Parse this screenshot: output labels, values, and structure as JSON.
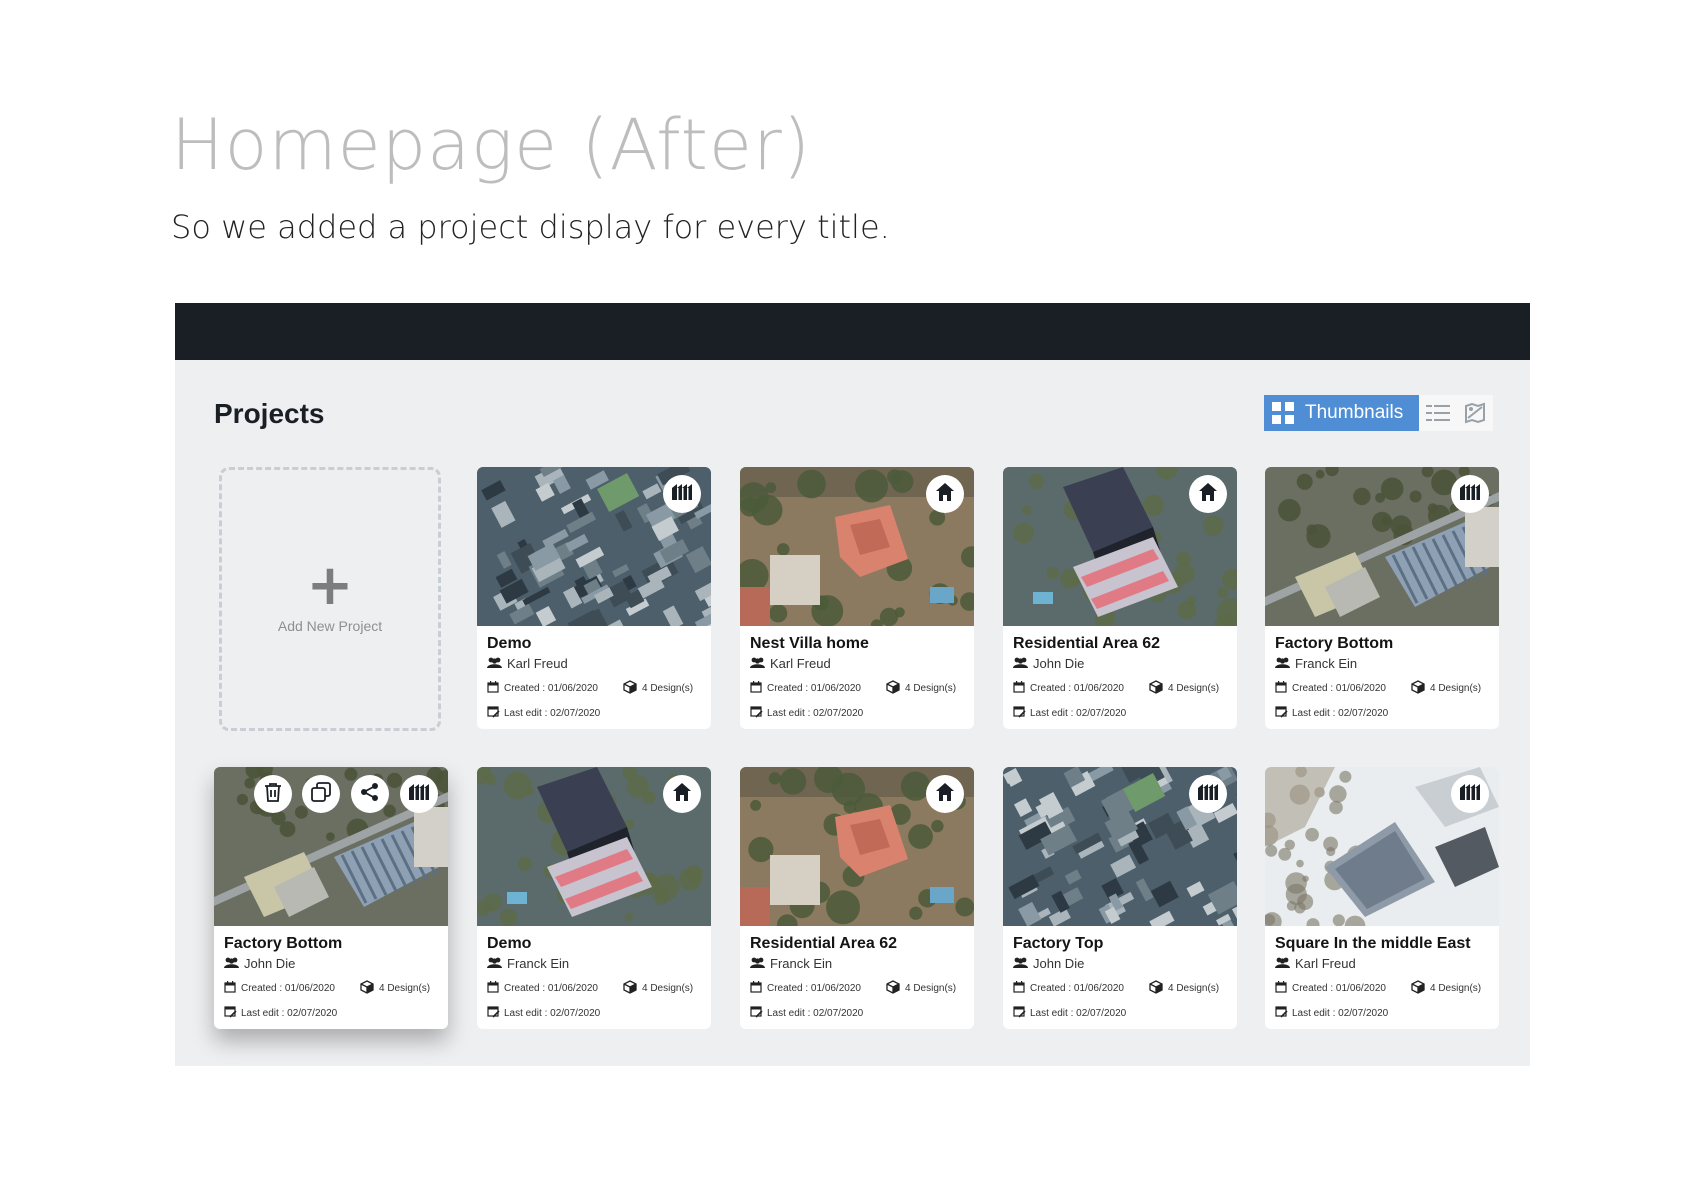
{
  "slide": {
    "heading": "Homepage (After)",
    "subheading": "So we added a project display for every title."
  },
  "app": {
    "section_title": "Projects",
    "view_switch": {
      "active_label": "Thumbnails",
      "options": [
        "thumbnails-grid-icon",
        "list-view-icon",
        "map-view-icon"
      ],
      "accent_color": "#4f8ed4"
    },
    "add_new": {
      "label": "Add New Project",
      "icon": "plus-icon"
    },
    "projects": [
      {
        "title": "Demo",
        "owner": "Karl Freud",
        "created": "Created : 01/06/2020",
        "designs": "4 Design(s)",
        "last_edit": "Last edit : 02/07/2020",
        "type_icon": "factory-icon",
        "image": "urban-aerial"
      },
      {
        "title": "Nest Villa home",
        "owner": "Karl Freud",
        "created": "Created : 01/06/2020",
        "designs": "4 Design(s)",
        "last_edit": "Last edit : 02/07/2020",
        "type_icon": "home-icon",
        "image": "villa-aerial"
      },
      {
        "title": "Residential Area 62",
        "owner": "John Die",
        "created": "Created : 01/06/2020",
        "designs": "4 Design(s)",
        "last_edit": "Last edit : 02/07/2020",
        "type_icon": "home-icon",
        "image": "tower-aerial"
      },
      {
        "title": "Factory Bottom",
        "owner": "Franck Ein",
        "created": "Created : 01/06/2020",
        "designs": "4 Design(s)",
        "last_edit": "Last edit : 02/07/2020",
        "type_icon": "factory-icon",
        "image": "factory-aerial"
      },
      {
        "title": "Factory Bottom",
        "owner": "John Die",
        "created": "Created : 01/06/2020",
        "designs": "4 Design(s)",
        "last_edit": "Last edit : 02/07/2020",
        "type_icon": "factory-icon",
        "image": "factory-aerial",
        "hover_actions": [
          "delete-icon",
          "duplicate-icon",
          "share-icon"
        ]
      },
      {
        "title": "Demo",
        "owner": "Franck Ein",
        "created": "Created : 01/06/2020",
        "designs": "4 Design(s)",
        "last_edit": "Last edit : 02/07/2020",
        "type_icon": "home-icon",
        "image": "tower-aerial"
      },
      {
        "title": "Residential Area 62",
        "owner": "Franck Ein",
        "created": "Created : 01/06/2020",
        "designs": "4 Design(s)",
        "last_edit": "Last edit : 02/07/2020",
        "type_icon": "home-icon",
        "image": "villa-aerial"
      },
      {
        "title": "Factory Top",
        "owner": "John Die",
        "created": "Created : 01/06/2020",
        "designs": "4 Design(s)",
        "last_edit": "Last edit : 02/07/2020",
        "type_icon": "factory-icon",
        "image": "urban-aerial"
      },
      {
        "title": "Square In the middle East",
        "owner": "Karl Freud",
        "created": "Created : 01/06/2020",
        "designs": "4 Design(s)",
        "last_edit": "Last edit : 02/07/2020",
        "type_icon": "factory-icon",
        "image": "snow-aerial"
      }
    ]
  }
}
